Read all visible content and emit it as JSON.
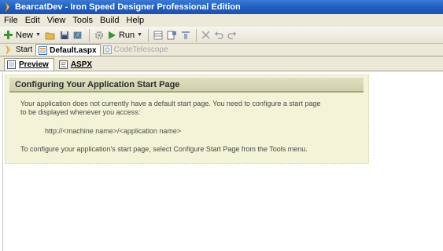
{
  "window": {
    "title": "BearcatDev - Iron Speed Designer Professional Edition"
  },
  "menu": [
    "File",
    "Edit",
    "View",
    "Tools",
    "Build",
    "Help"
  ],
  "toolbar": {
    "new_label": "New",
    "run_label": "Run",
    "icons": [
      "plus-icon",
      "open-folder-icon",
      "save-icon",
      "refresh-icon",
      "settings-icon",
      "run-icon",
      "layout-icon",
      "properties-icon",
      "align-icon",
      "delete-icon",
      "undo-icon",
      "redo-icon"
    ]
  },
  "doc_tabs": [
    {
      "label": "Start",
      "active": false
    },
    {
      "label": "Default.aspx",
      "active": true
    },
    {
      "label": "CodeTelescope",
      "active": false
    }
  ],
  "view_tabs": [
    {
      "label": "Preview",
      "active": true
    },
    {
      "label": "ASPX",
      "active": false
    }
  ],
  "panel": {
    "header": "Configuring Your Application Start Page",
    "line1": "Your application does not currently have a default start page.  You need to configure a start page",
    "line2": "to be displayed whenever you access:",
    "url": "http://<machine name>/<application name>",
    "footer": "To configure your application's start page, select Configure Start Page from the Tools menu."
  },
  "colors": {
    "title_bar": "#1f5fc4",
    "chrome": "#ece9d8",
    "panel_bg": "#f3f3d7",
    "panel_header": "#d6d7b5"
  }
}
